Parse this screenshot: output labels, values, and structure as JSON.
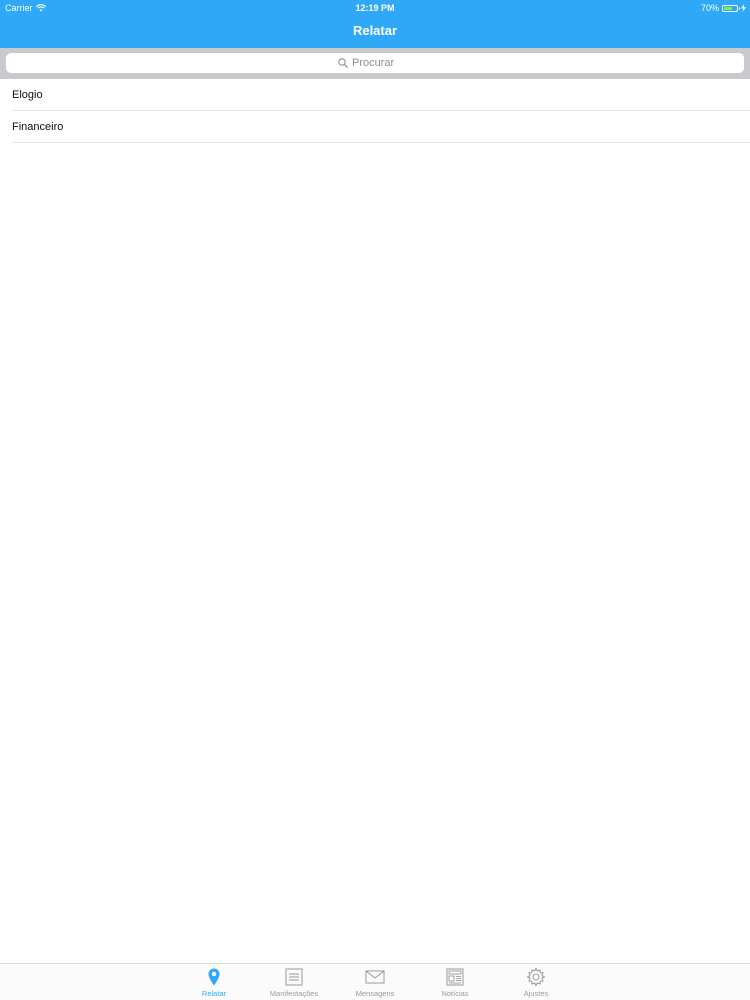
{
  "status_bar": {
    "carrier": "Carrier",
    "time": "12:19 PM",
    "battery": "70%",
    "battery_level": 0.7
  },
  "nav": {
    "title": "Relatar"
  },
  "search": {
    "placeholder": "Procurar",
    "icon": "search-icon"
  },
  "list": {
    "items": [
      {
        "label": "Elogio"
      },
      {
        "label": "Financeiro"
      }
    ]
  },
  "tabs": [
    {
      "label": "Relatar",
      "icon": "map-pin-icon",
      "active": true
    },
    {
      "label": "Manifestações",
      "icon": "list-icon",
      "active": false
    },
    {
      "label": "Mensagens",
      "icon": "envelope-icon",
      "active": false
    },
    {
      "label": "Notícias",
      "icon": "newspaper-icon",
      "active": false
    },
    {
      "label": "Ajustes",
      "icon": "gear-icon",
      "active": false
    }
  ],
  "colors": {
    "accent": "#2fa9f7",
    "tab_inactive": "#9a9a9a",
    "battery": "#7cf34e"
  }
}
